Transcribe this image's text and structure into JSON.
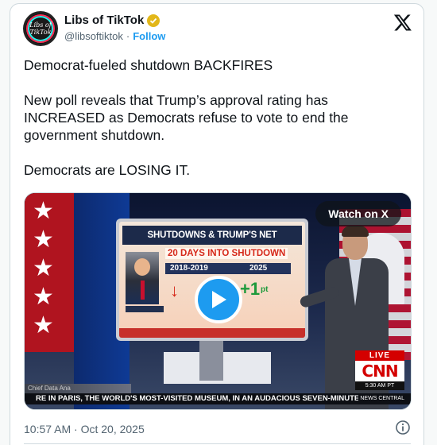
{
  "account": {
    "name": "Libs of TikTok",
    "handle": "@libsoftiktok",
    "separator": "·",
    "follow_label": "Follow",
    "avatar_text": "Libs of TikTok"
  },
  "tweet": {
    "paragraphs": [
      "Democrat-fueled shutdown BACKFIRES",
      "New poll reveals that Trump’s approval rating has INCREASED as Democrats refuse to vote to end the government shutdown.",
      "Democrats are LOSING IT."
    ],
    "timestamp": "10:57 AM · Oct 20, 2025"
  },
  "media": {
    "watch_label": "Watch on X",
    "screen_title": "SHUTDOWNS & TRUMP'S NET APPROVAL",
    "screen_subtitle": "20 DAYS INTO SHUTDOWN",
    "year_left": "2018-2019",
    "year_right": "2025",
    "change_left": "↓",
    "change_right": "+1",
    "change_right_suffix": "pt",
    "live_label": "LIVE",
    "cnn_logo": "CNN",
    "cnn_time": "5:30 AM PT",
    "lower_left": "Chief Data Ana",
    "ticker_text": "RE IN PARIS, THE WORLD'S MOST-VISITED MUSEUM, IN AN AUDACIOUS SEVEN-MINUTE",
    "ticker_brand": "NEWS CENTRAL"
  },
  "icons": {
    "verified": "verified-badge-icon",
    "x_logo": "x-logo-icon",
    "play": "play-icon",
    "info": "info-icon"
  },
  "colors": {
    "follow": "#1d9bf0",
    "verified": "#e2b719",
    "play_button": "#1d9bf0",
    "cnn_red": "#d40000"
  }
}
